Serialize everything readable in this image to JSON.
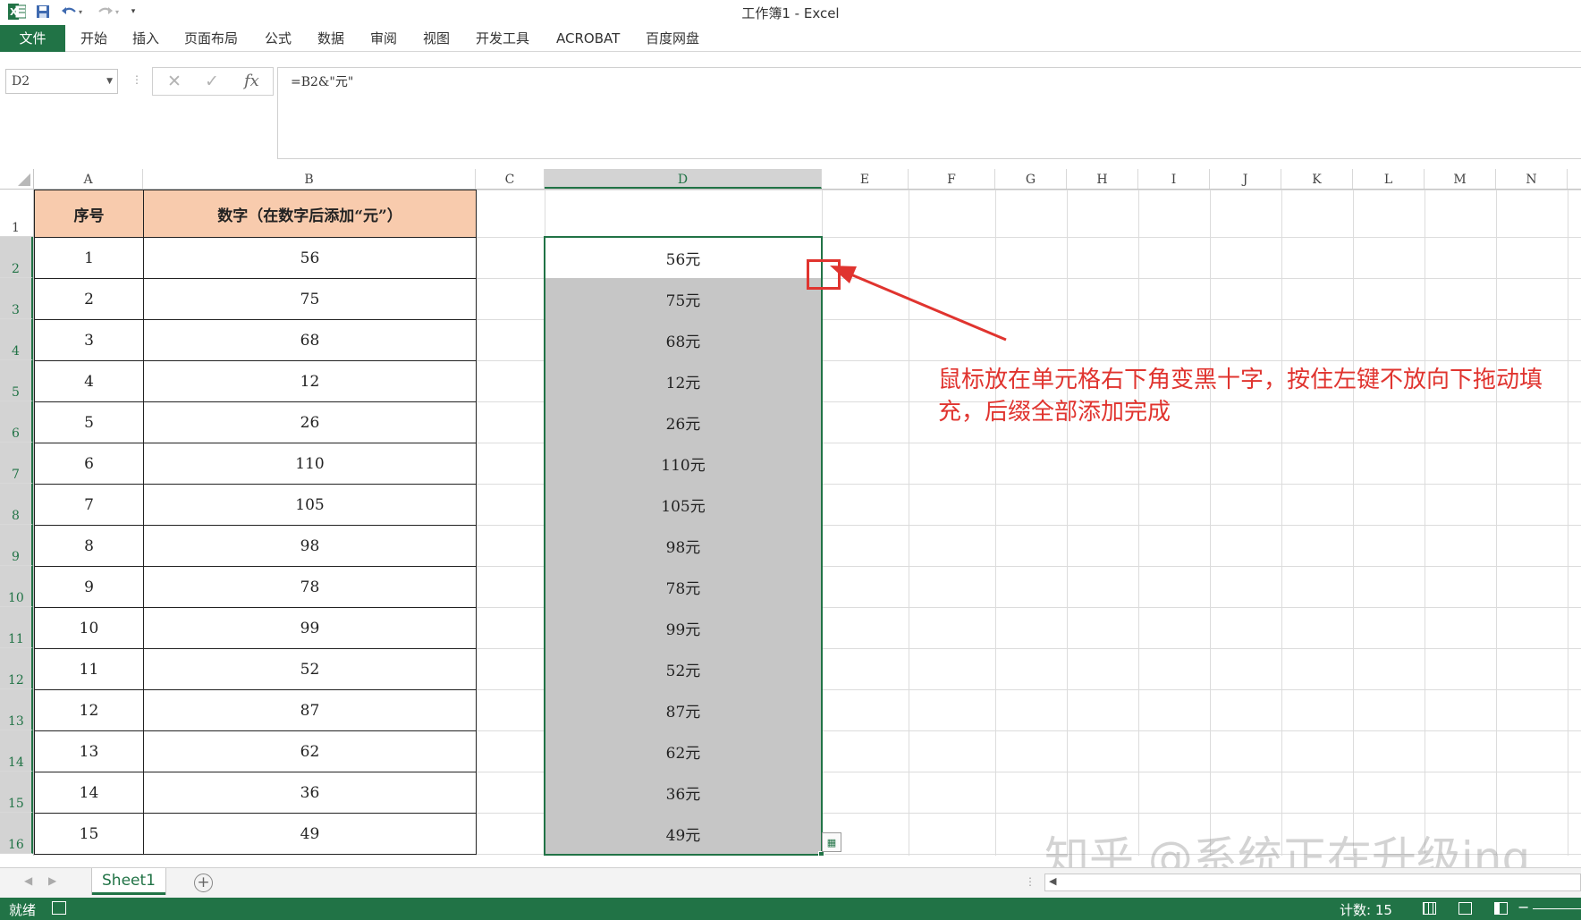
{
  "window": {
    "title": "工作簿1 - Excel",
    "app_icon": "excel-icon"
  },
  "quick_access": {
    "save": "save-icon",
    "undo": "undo-icon",
    "redo": "redo-icon",
    "customize": "chevron-down-icon"
  },
  "ribbon": {
    "file_tab": "文件",
    "tabs": [
      "开始",
      "插入",
      "页面布局",
      "公式",
      "数据",
      "审阅",
      "视图",
      "开发工具",
      "ACROBAT",
      "百度网盘"
    ]
  },
  "formula_bar": {
    "name_box": "D2",
    "cancel_icon": "✕",
    "enter_icon": "✓",
    "fx_label": "fx",
    "formula": "=B2&\"元\""
  },
  "grid": {
    "columns": [
      "A",
      "B",
      "C",
      "D",
      "E",
      "F",
      "G",
      "H",
      "I",
      "J",
      "K",
      "L",
      "M",
      "N"
    ],
    "selected_column": "D",
    "rows": [
      "1",
      "2",
      "3",
      "4",
      "5",
      "6",
      "7",
      "8",
      "9",
      "10",
      "11",
      "12",
      "13",
      "14",
      "15",
      "16"
    ],
    "header": {
      "a1": "序号",
      "b1": "数字（在数字后添加“元”）"
    },
    "data": [
      {
        "a": "1",
        "b": "56",
        "d": "56元"
      },
      {
        "a": "2",
        "b": "75",
        "d": "75元"
      },
      {
        "a": "3",
        "b": "68",
        "d": "68元"
      },
      {
        "a": "4",
        "b": "12",
        "d": "12元"
      },
      {
        "a": "5",
        "b": "26",
        "d": "26元"
      },
      {
        "a": "6",
        "b": "110",
        "d": "110元"
      },
      {
        "a": "7",
        "b": "105",
        "d": "105元"
      },
      {
        "a": "8",
        "b": "98",
        "d": "98元"
      },
      {
        "a": "9",
        "b": "78",
        "d": "78元"
      },
      {
        "a": "10",
        "b": "99",
        "d": "99元"
      },
      {
        "a": "11",
        "b": "52",
        "d": "52元"
      },
      {
        "a": "12",
        "b": "87",
        "d": "87元"
      },
      {
        "a": "13",
        "b": "62",
        "d": "62元"
      },
      {
        "a": "14",
        "b": "36",
        "d": "36元"
      },
      {
        "a": "15",
        "b": "49",
        "d": "49元"
      }
    ]
  },
  "annotation": {
    "line1": "鼠标放在单元格右下角变黑十字，按住左键不放向下拖动填",
    "line2": "充，后缀全部添加完成",
    "color": "#e0342f"
  },
  "watermark": "知乎 @系统正在升级ing",
  "sheets": {
    "active": "Sheet1",
    "add_icon": "plus-circle-icon"
  },
  "status": {
    "ready": "就绪",
    "count": "计数: 15",
    "zoom_minus": "−"
  },
  "colors": {
    "excel_green": "#217346",
    "header_fill": "#f8cbad",
    "selection_fill": "#c6c6c6"
  }
}
